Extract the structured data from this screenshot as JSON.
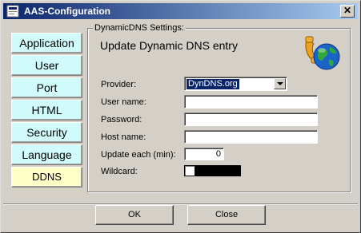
{
  "window": {
    "title": "AAS-Configuration"
  },
  "nav": {
    "items": [
      {
        "label": "Application"
      },
      {
        "label": "User"
      },
      {
        "label": "Port"
      },
      {
        "label": "HTML"
      },
      {
        "label": "Security"
      },
      {
        "label": "Language"
      },
      {
        "label": "DDNS",
        "selected": true
      }
    ]
  },
  "dyndns": {
    "group_title": "DynamicDNS Settings:",
    "heading": "Update Dynamic DNS entry",
    "provider_label": "Provider:",
    "provider_value": "DynDNS.org",
    "username_label": "User name:",
    "username_value": "",
    "password_label": "Password:",
    "password_value": "",
    "hostname_label": "Host name:",
    "hostname_value": "",
    "update_label": "Update each (min):",
    "update_value": "0",
    "wildcard_label": "Wildcard:",
    "wildcard_checked": false
  },
  "buttons": {
    "ok": "OK",
    "close": "Close"
  },
  "colors": {
    "nav_bg": "#d1fbfb",
    "nav_active_bg": "#ffffc8",
    "title_start": "#0a246a",
    "title_end": "#a6caf0"
  }
}
